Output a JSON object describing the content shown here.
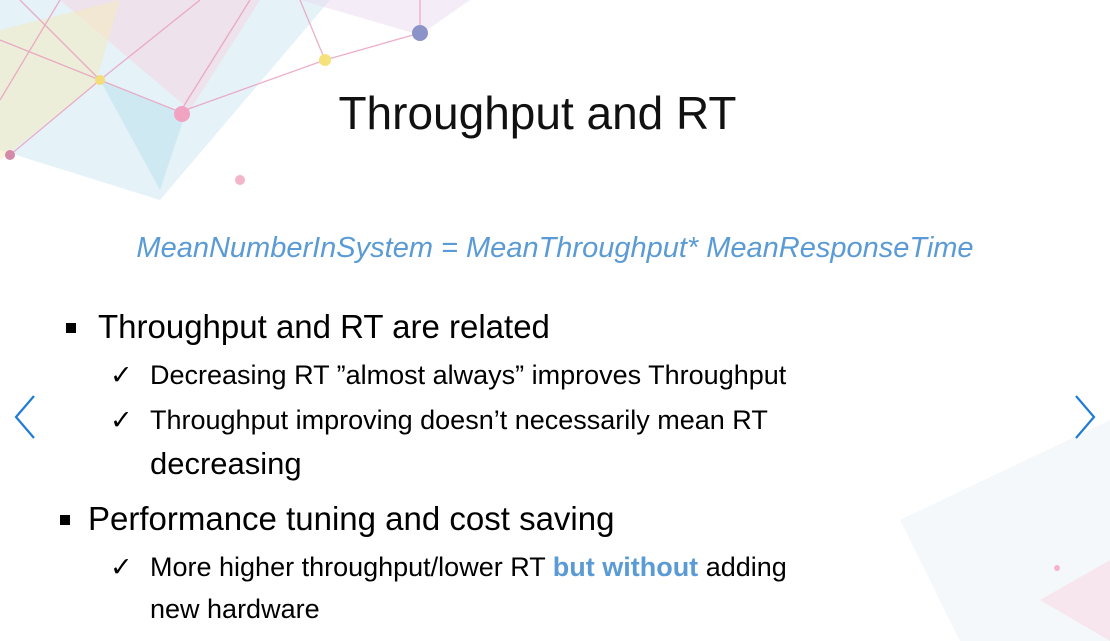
{
  "slide": {
    "title": "Throughput and RT",
    "formula": "MeanNumberInSystem = MeanThroughput* MeanResponseTime",
    "bullets": [
      {
        "text": "Throughput and RT are related",
        "subs": [
          "Decreasing RT ”almost always” improves Throughput",
          "Throughput improving doesn’t necessarily mean RT",
          "decreasing"
        ]
      },
      {
        "text": "Performance tuning and cost saving",
        "sub_before": "More higher throughput/lower RT ",
        "sub_emphasis": "but without",
        "sub_after": " adding",
        "sub_line2": "new hardware"
      }
    ],
    "check_glyph": "✓"
  },
  "navigation": {
    "prev_icon": "chevron-left-icon",
    "next_icon": "chevron-right-icon",
    "color": "#1e7bd6"
  },
  "colors": {
    "accent": "#5b9bd5"
  }
}
